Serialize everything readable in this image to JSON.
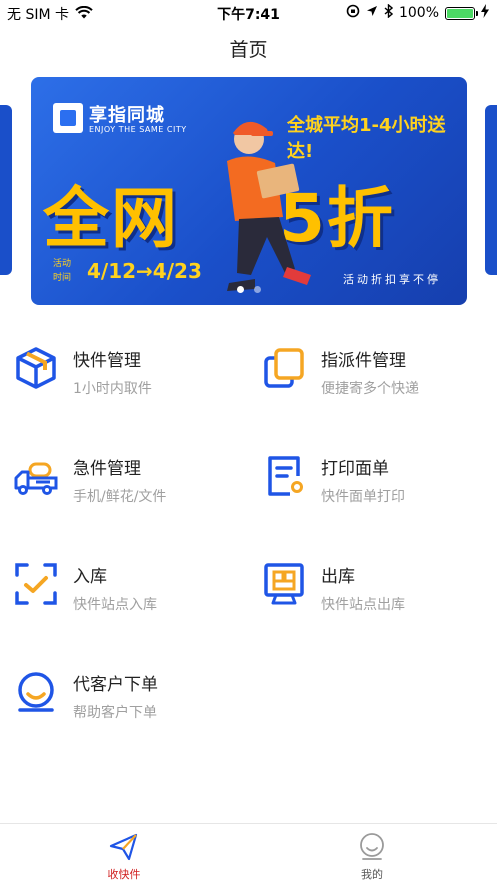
{
  "status_bar": {
    "carrier": "无 SIM 卡",
    "time": "下午7:41",
    "battery": "100%",
    "battery_level": 1.0
  },
  "nav": {
    "title": "首页"
  },
  "banner": {
    "brand_name": "享指同城",
    "brand_en": "ENJOY THE SAME CITY",
    "slogan": "全城平均1-4小时送达!",
    "headline_left": "全网",
    "headline_right": "5折",
    "date_label": "活动时间",
    "date_range": "4/12→4/23",
    "tagline": "活动折扣享不停",
    "page_count": 2,
    "active_page": 1,
    "colors": {
      "background": "#1a4fc9",
      "headline": "#ffc000",
      "slogan": "#ffd21e"
    }
  },
  "features": [
    {
      "title": "快件管理",
      "subtitle": "1小时内取件",
      "icon": "package-box-icon"
    },
    {
      "title": "指派件管理",
      "subtitle": "便捷寄多个快递",
      "icon": "stacked-cards-icon"
    },
    {
      "title": "急件管理",
      "subtitle": "手机/鲜花/文件",
      "icon": "delivery-truck-icon"
    },
    {
      "title": "打印面单",
      "subtitle": "快件面单打印",
      "icon": "print-slip-icon"
    },
    {
      "title": "入库",
      "subtitle": "快件站点入库",
      "icon": "scan-check-icon"
    },
    {
      "title": "出库",
      "subtitle": "快件站点出库",
      "icon": "warehouse-out-icon"
    },
    {
      "title": "代客户下单",
      "subtitle": "帮助客户下单",
      "icon": "customer-order-icon"
    }
  ],
  "tabbar": {
    "items": [
      {
        "label": "收快件",
        "icon": "paper-plane-icon",
        "active": true
      },
      {
        "label": "我的",
        "icon": "profile-smile-icon",
        "active": false
      }
    ],
    "colors": {
      "active": "#d01f1f",
      "inactive": "#555555"
    }
  },
  "colors": {
    "icon_blue": "#1f55e6",
    "icon_orange": "#f5a623",
    "subtitle_gray": "#a0a0a0"
  }
}
